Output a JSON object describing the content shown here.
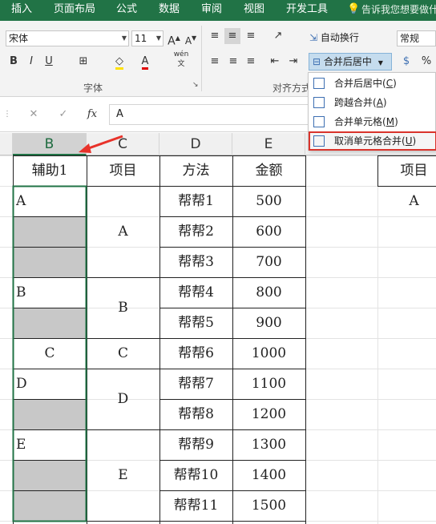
{
  "tabs": [
    "插入",
    "页面布局",
    "公式",
    "数据",
    "审阅",
    "视图",
    "开发工具"
  ],
  "tell_me": "告诉我您想要做什",
  "font": {
    "name": "宋体",
    "size": "11",
    "group_label": "字体"
  },
  "alignment": {
    "group_label": "对齐方式",
    "wrap_text": "自动换行",
    "merge_center": "合并后居中"
  },
  "number_format": "常规",
  "formula_bar": {
    "value": "A"
  },
  "menu": {
    "items": [
      {
        "label": "合并后居中",
        "key": "C"
      },
      {
        "label": "跨越合并",
        "key": "A"
      },
      {
        "label": "合并单元格",
        "key": "M"
      },
      {
        "label": "取消单元格合并",
        "key": "U"
      }
    ]
  },
  "columns": [
    "B",
    "C",
    "D",
    "E"
  ],
  "headers": [
    "辅助1",
    "项目",
    "方法",
    "金额"
  ],
  "right_header": "项目",
  "right_value": "A",
  "b_values": [
    "A",
    "",
    "",
    "B",
    "",
    "C",
    "D",
    "",
    "E",
    "",
    ""
  ],
  "c_groups": [
    "A",
    "B",
    "C",
    "D",
    "E"
  ],
  "d_values": [
    "帮帮1",
    "帮帮2",
    "帮帮3",
    "帮帮4",
    "帮帮5",
    "帮帮6",
    "帮帮7",
    "帮帮8",
    "帮帮9",
    "帮帮10",
    "帮帮11"
  ],
  "e_values": [
    "500",
    "600",
    "700",
    "800",
    "900",
    "1000",
    "1100",
    "1200",
    "1300",
    "1400",
    "1500"
  ],
  "colors": {
    "ribbon_tab": "#217346",
    "selection_fill": "#c8c8c8",
    "highlight": "#d9332b"
  }
}
